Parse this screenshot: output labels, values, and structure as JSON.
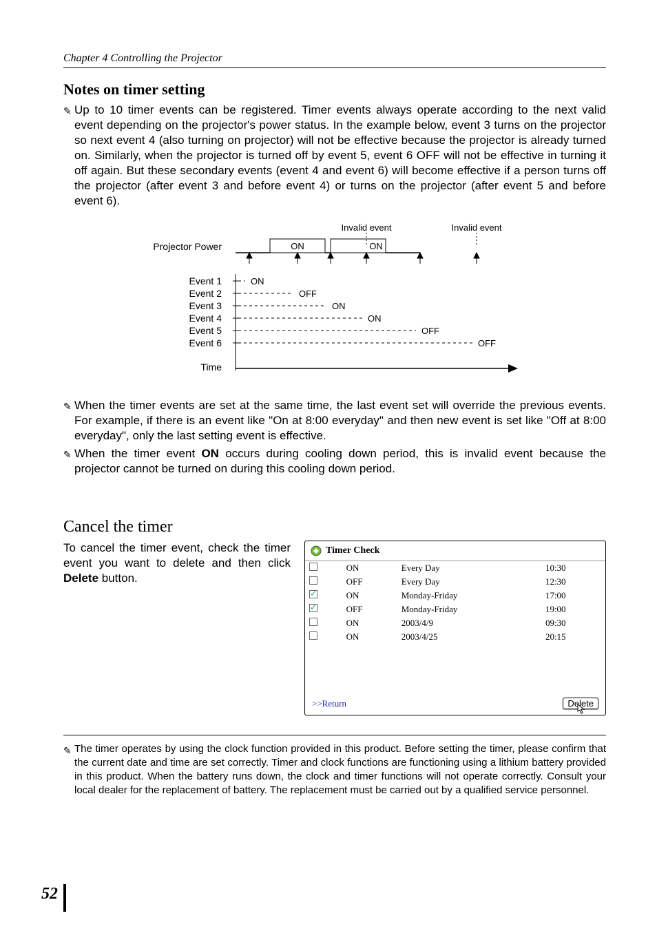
{
  "chapter": "Chapter 4 Controlling the Projector",
  "section1": {
    "title": "Notes on timer setting",
    "para1": "Up to 10 timer events can be registered. Timer events always operate according to the next valid event depending on the projector's power status. In the example below, event 3 turns on the projector so next event 4 (also turning on projector) will not be effective because the projector is already turned on. Similarly, when the projector is turned off by event 5, event 6 OFF will not be effective in turning it off again. But these secondary events (event 4 and event 6) will become effective if a person turns off the projector (after event 3 and before event 4) or turns on the projector (after event 5 and before event 6).",
    "para2": "When the timer events are set at the same time, the last event set will override the previous events. For example, if there is an event like \"On at 8:00 everyday\" and then new event is set like \"Off at 8:00 everyday\", only the last setting event is effective.",
    "para3_a": "When the timer event ",
    "para3_b": "ON",
    "para3_c": " occurs during cooling down period, this is invalid event because the projector cannot be turned on during this cooling down period."
  },
  "diagram": {
    "invalid1": "Invalid event",
    "invalid2": "Invalid event",
    "power_label": "Projector Power",
    "on1": "ON",
    "on2": "ON",
    "rows": [
      "Event 1",
      "Event 2",
      "Event 3",
      "Event 4",
      "Event 5",
      "Event 6"
    ],
    "row_vals": [
      "ON",
      "OFF",
      "ON",
      "ON",
      "OFF",
      "OFF"
    ],
    "time_label": "Time"
  },
  "section2": {
    "title": "Cancel the timer",
    "para_a": "To cancel the timer event, check the timer event you want to delete and then click ",
    "para_b": "Delete",
    "para_c": " button."
  },
  "timer_panel": {
    "title": "Timer Check",
    "rows": [
      {
        "checked": false,
        "state": "ON",
        "day": "Every Day",
        "time": "10:30"
      },
      {
        "checked": false,
        "state": "OFF",
        "day": "Every Day",
        "time": "12:30"
      },
      {
        "checked": true,
        "state": "ON",
        "day": "Monday-Friday",
        "time": "17:00"
      },
      {
        "checked": true,
        "state": "OFF",
        "day": "Monday-Friday",
        "time": "19:00"
      },
      {
        "checked": false,
        "state": "ON",
        "day": "2003/4/9",
        "time": "09:30"
      },
      {
        "checked": false,
        "state": "ON",
        "day": "2003/4/25",
        "time": "20:15"
      }
    ],
    "return": ">>Return",
    "delete": "Delete"
  },
  "footnote": "The timer operates by using the clock function provided in this product. Before setting the timer, please confirm that the current date and time are set correctly. Timer and clock functions are functioning using a lithium battery provided in this product. When the battery runs down, the clock and timer functions will not operate correctly. Consult your local dealer for the replacement of battery. The replacement must be carried out by a qualified service personnel.",
  "page_number": "52"
}
